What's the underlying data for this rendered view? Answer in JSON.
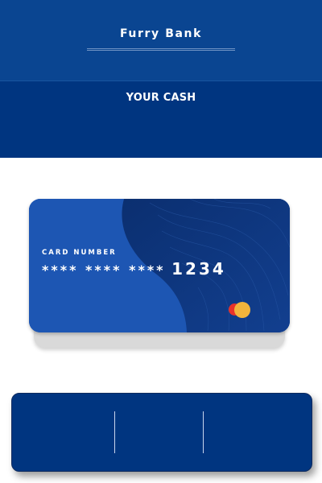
{
  "header": {
    "app_title": "Furry Bank",
    "section_label": "YOUR CASH"
  },
  "card": {
    "number_label": "CARD NUMBER",
    "masked_digits": "**** **** ****",
    "last_four": "1234",
    "network_icon": "mastercard-logo-icon"
  },
  "bottom_panel": {
    "sections": 3
  },
  "colors": {
    "header_top": "#0a4591",
    "header_bottom": "#003580",
    "card_primary": "#1d56b3",
    "card_dark": "#0d3378",
    "panel": "#003580"
  }
}
